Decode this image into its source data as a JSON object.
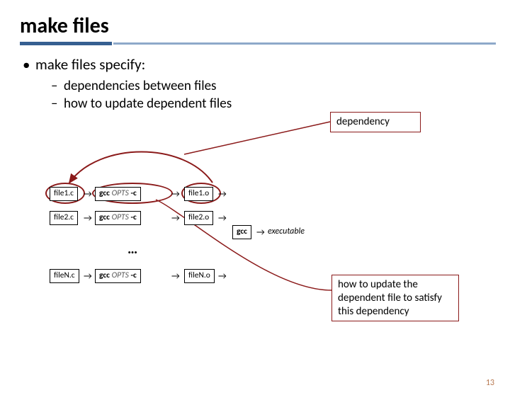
{
  "title": "make files",
  "bullets": {
    "b1": "make files specify:",
    "b2a": "dependencies between files",
    "b2b": "how to update dependent files"
  },
  "callouts": {
    "dependency": "dependency",
    "update": "how to update the dependent  file to satisfy this dependency"
  },
  "diagram": {
    "file1c": "file1.c",
    "file2c": "file2.c",
    "fileNc": "fileN.c",
    "gcc": "gcc",
    "opts": "OPTS",
    "dashc": "-c",
    "file1o": "file1.o",
    "file2o": "file2.o",
    "fileNo": "fileN.o",
    "executable": "executable",
    "ellipsis": "…"
  },
  "page_number": "13"
}
